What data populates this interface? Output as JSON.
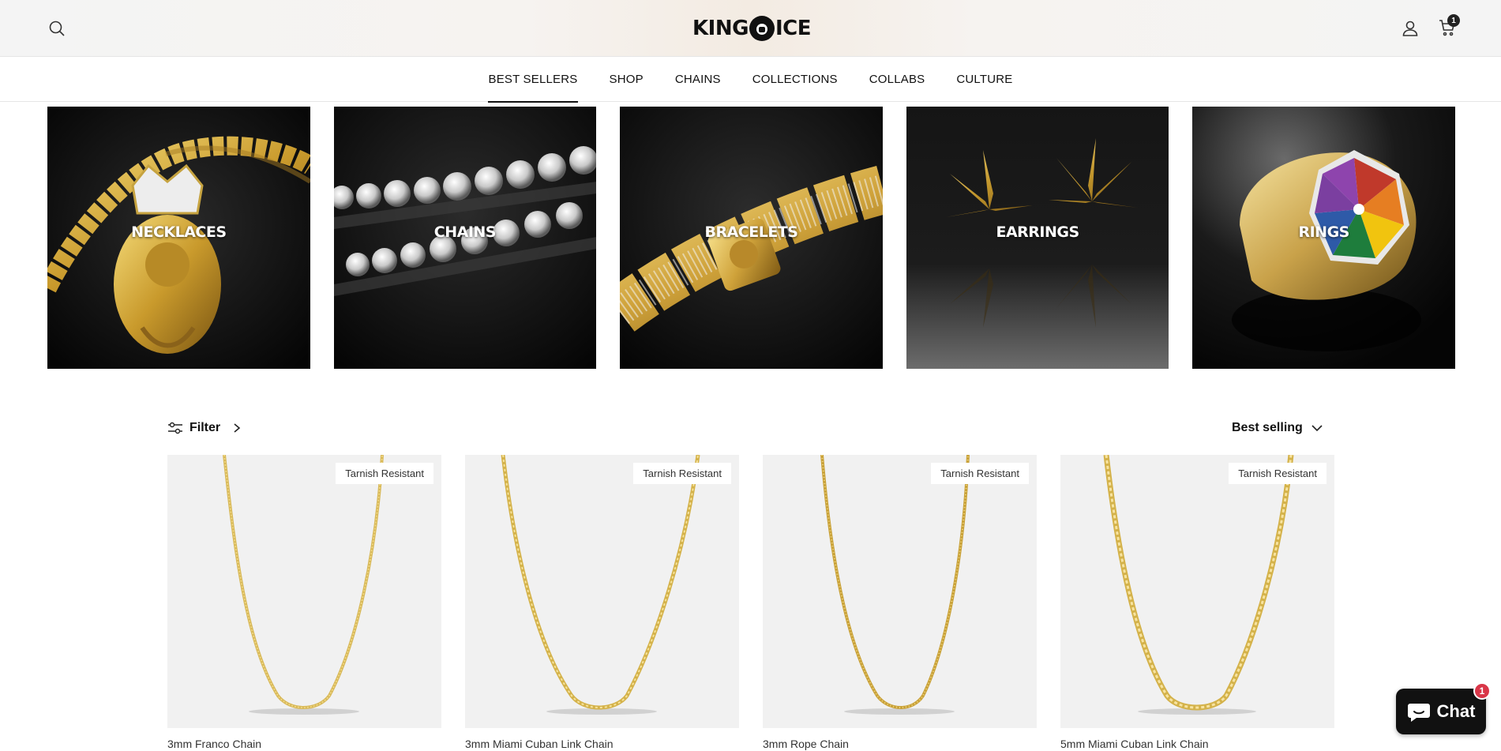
{
  "header": {
    "logo_text_left": "KING",
    "logo_text_right": "ICE",
    "cart_count": "1"
  },
  "nav": {
    "items": [
      {
        "label": "BEST SELLERS",
        "active": true
      },
      {
        "label": "SHOP"
      },
      {
        "label": "CHAINS"
      },
      {
        "label": "COLLECTIONS"
      },
      {
        "label": "COLLABS"
      },
      {
        "label": "CULTURE"
      }
    ]
  },
  "categories": [
    {
      "label": "NECKLACES"
    },
    {
      "label": "CHAINS"
    },
    {
      "label": "BRACELETS"
    },
    {
      "label": "EARRINGS"
    },
    {
      "label": "RINGS"
    }
  ],
  "toolbar": {
    "filter_label": "Filter",
    "sort_label": "Best selling"
  },
  "products": [
    {
      "badge": "Tarnish Resistant",
      "title": "3mm Franco Chain"
    },
    {
      "badge": "Tarnish Resistant",
      "title": "3mm Miami Cuban Link Chain"
    },
    {
      "badge": "Tarnish Resistant",
      "title": "3mm Rope Chain"
    },
    {
      "badge": "Tarnish Resistant",
      "title": "5mm Miami Cuban Link Chain"
    }
  ],
  "chat": {
    "label": "Chat",
    "badge": "1"
  },
  "colors": {
    "chat_badge": "#d93648",
    "gold": "#d4b24a"
  }
}
